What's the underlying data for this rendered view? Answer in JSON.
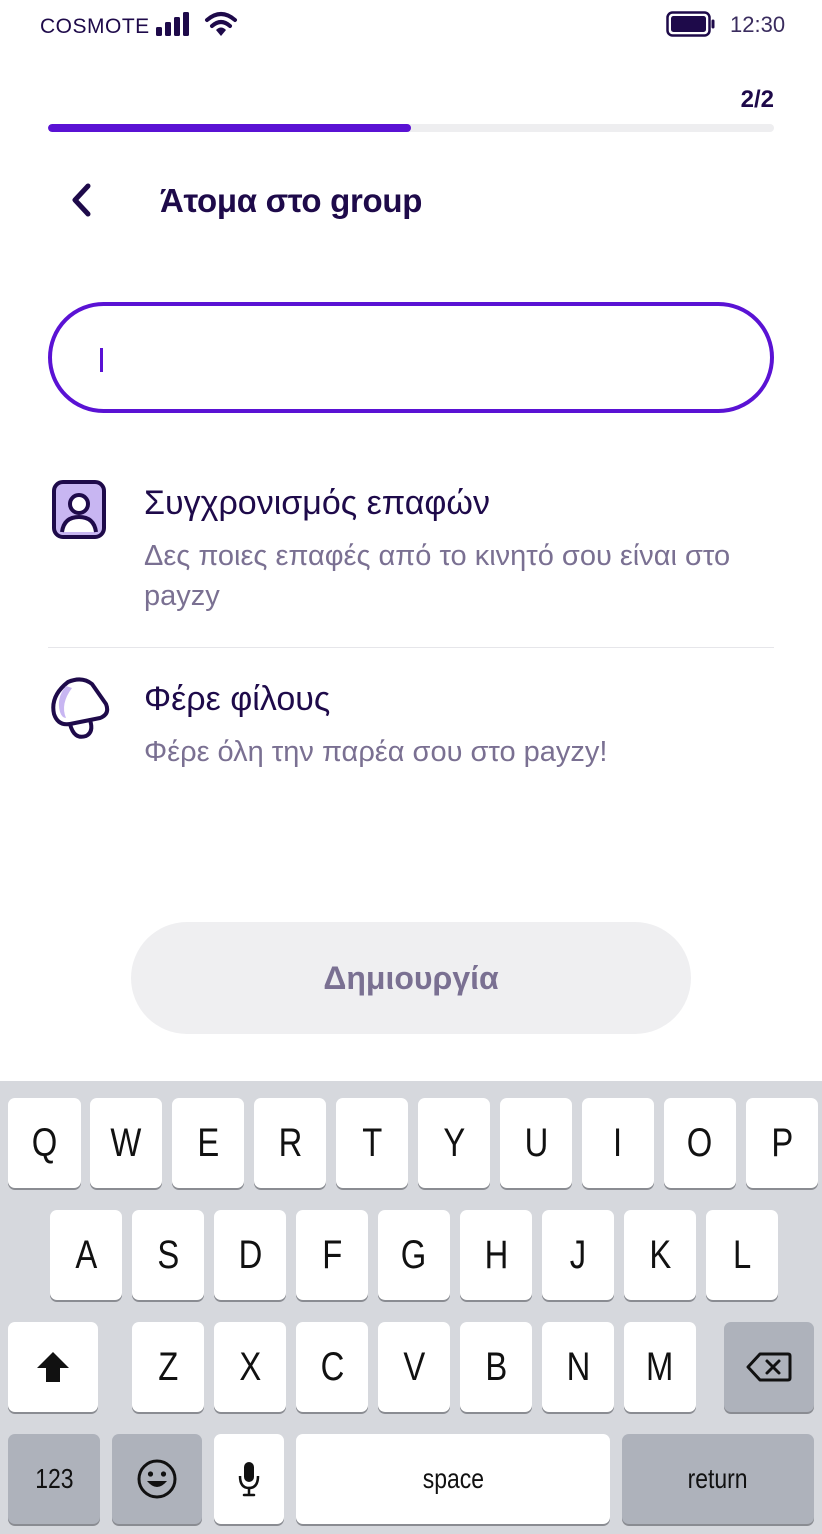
{
  "status_bar": {
    "carrier": "COSMOTE",
    "time": "12:30",
    "signal_icon": "signal-bars-icon",
    "wifi_icon": "wifi-icon",
    "battery_icon": "battery-full-icon"
  },
  "progress": {
    "step_label": "2/2",
    "fraction": 0.5,
    "color": "#5a12d4"
  },
  "header": {
    "title": "Άτομα στο group",
    "back_icon": "chevron-left-icon"
  },
  "search": {
    "value": "",
    "border_color": "#5a12d4"
  },
  "options": [
    {
      "icon": "contact-sync-icon",
      "title": "Συγχρονισμός επαφών",
      "description": "Δες ποιες επαφές από το κινητό σου είναι στο payzy"
    },
    {
      "icon": "megaphone-icon",
      "title": "Φέρε φίλους",
      "description": "Φέρε όλη την παρέα σου στο payzy!"
    }
  ],
  "create_button": {
    "label": "Δημιουργία",
    "state": "disabled"
  },
  "keyboard": {
    "row1": [
      "Q",
      "W",
      "E",
      "R",
      "T",
      "Y",
      "U",
      "I",
      "O",
      "P"
    ],
    "row2": [
      "A",
      "S",
      "D",
      "F",
      "G",
      "H",
      "J",
      "K",
      "L"
    ],
    "row3": [
      "Z",
      "X",
      "C",
      "V",
      "B",
      "N",
      "M"
    ],
    "numbers_label": "123",
    "space_label": "space",
    "return_label": "return",
    "shift_icon": "shift-icon",
    "backspace_icon": "backspace-icon",
    "emoji_icon": "emoji-icon",
    "mic_icon": "microphone-icon"
  }
}
